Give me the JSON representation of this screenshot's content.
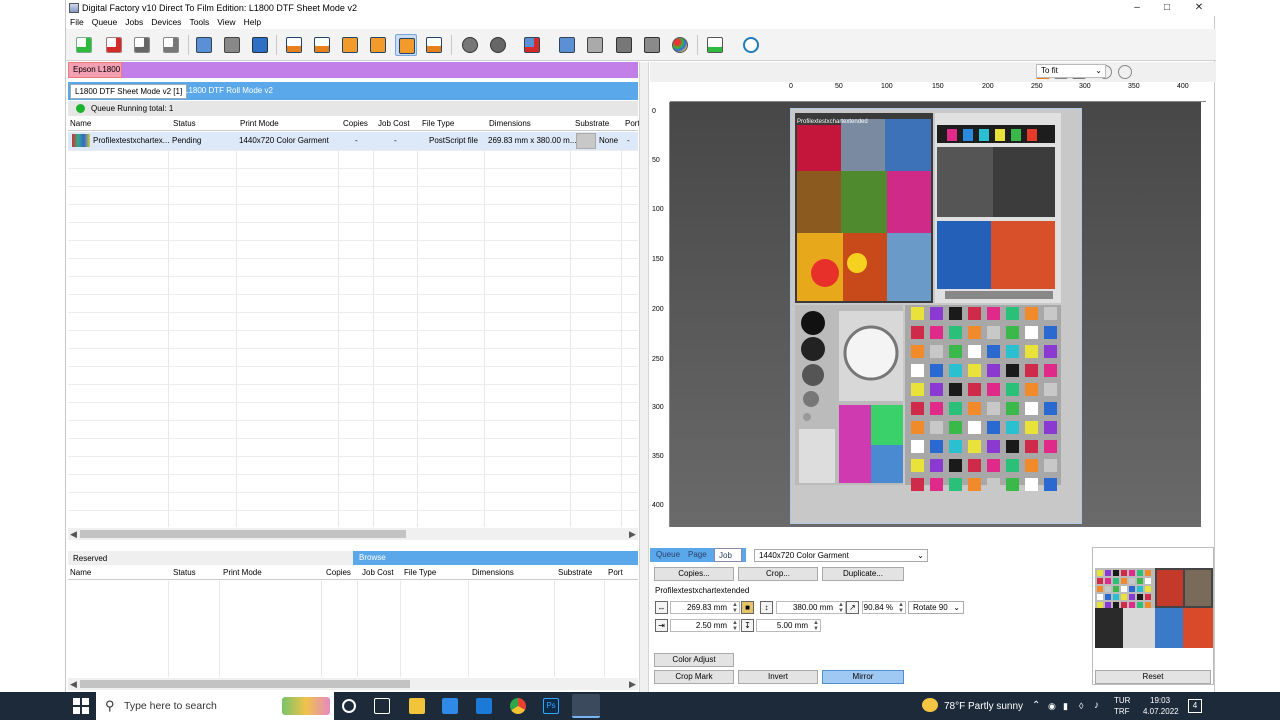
{
  "window": {
    "title": "Digital Factory v10 Direct To Film Edition: L1800 DTF Sheet Mode v2",
    "minimize": "–",
    "maximize": "□",
    "close": "✕"
  },
  "menu": [
    "File",
    "Queue",
    "Jobs",
    "Devices",
    "Tools",
    "View",
    "Help"
  ],
  "printer": {
    "name": "Epson L1800"
  },
  "queue_tabs": [
    {
      "label": "L1800 DTF Sheet Mode v2 [1]",
      "active": true
    },
    {
      "label": "L1800 DTF Roll Mode v2",
      "active": false
    }
  ],
  "queue_status": "Queue Running   total: 1",
  "job_columns": [
    "Name",
    "Status",
    "Print Mode",
    "Copies",
    "Job Cost",
    "File Type",
    "Dimensions",
    "Substrate",
    "Port"
  ],
  "jobs": [
    {
      "name": "Profilextestxchartex...",
      "status": "Pending",
      "print_mode": "1440x720 Color Garment",
      "copies": "-",
      "job_cost": "-",
      "file_type": "PostScript file",
      "dimensions": "269.83 mm x 380.00 m...",
      "substrate": "None",
      "port": "-"
    }
  ],
  "reserved": {
    "label": "Reserved",
    "browse": "Browse",
    "columns": [
      "Name",
      "Status",
      "Print Mode",
      "Copies",
      "Job Cost",
      "File Type",
      "Dimensions",
      "Substrate",
      "Port"
    ]
  },
  "preview": {
    "zoom": "To fit",
    "ruler_top": [
      "0",
      "50",
      "100",
      "150",
      "200",
      "250",
      "300",
      "350",
      "400"
    ],
    "ruler_left": [
      "0",
      "50",
      "100",
      "150",
      "200",
      "250",
      "300",
      "350",
      "400"
    ],
    "artwork_caption": "Profilextestxchartextended"
  },
  "job_panel": {
    "tabs": [
      "Queue",
      "Page",
      "Job"
    ],
    "print_mode": "1440x720 Color Garment",
    "buttons": {
      "copies": "Copies...",
      "crop": "Crop...",
      "duplicate": "Duplicate..."
    },
    "job_name": "Profilextestxchartextended",
    "width": "269.83 mm",
    "height": "380.00 mm",
    "scale": "90.84 %",
    "rotate": "Rotate 90",
    "offset_x": "2.50 mm",
    "offset_y": "5.00 mm",
    "color_adjust": "Color Adjust",
    "crop_mark": "Crop Mark",
    "invert": "Invert",
    "mirror": "Mirror",
    "reset": "Reset"
  },
  "taskbar": {
    "search_placeholder": "Type here to search",
    "weather": "78°F  Partly sunny",
    "lang_top": "TUR",
    "lang_bottom": "TRF",
    "time": "19:03",
    "date": "4.07.2022",
    "notifications": "4"
  },
  "colors": {
    "accent_blue": "#5aa8ea",
    "printer_bar": "#c37fe8",
    "mirror_on": "#9fc8f2",
    "running_green": "#1db32c"
  }
}
